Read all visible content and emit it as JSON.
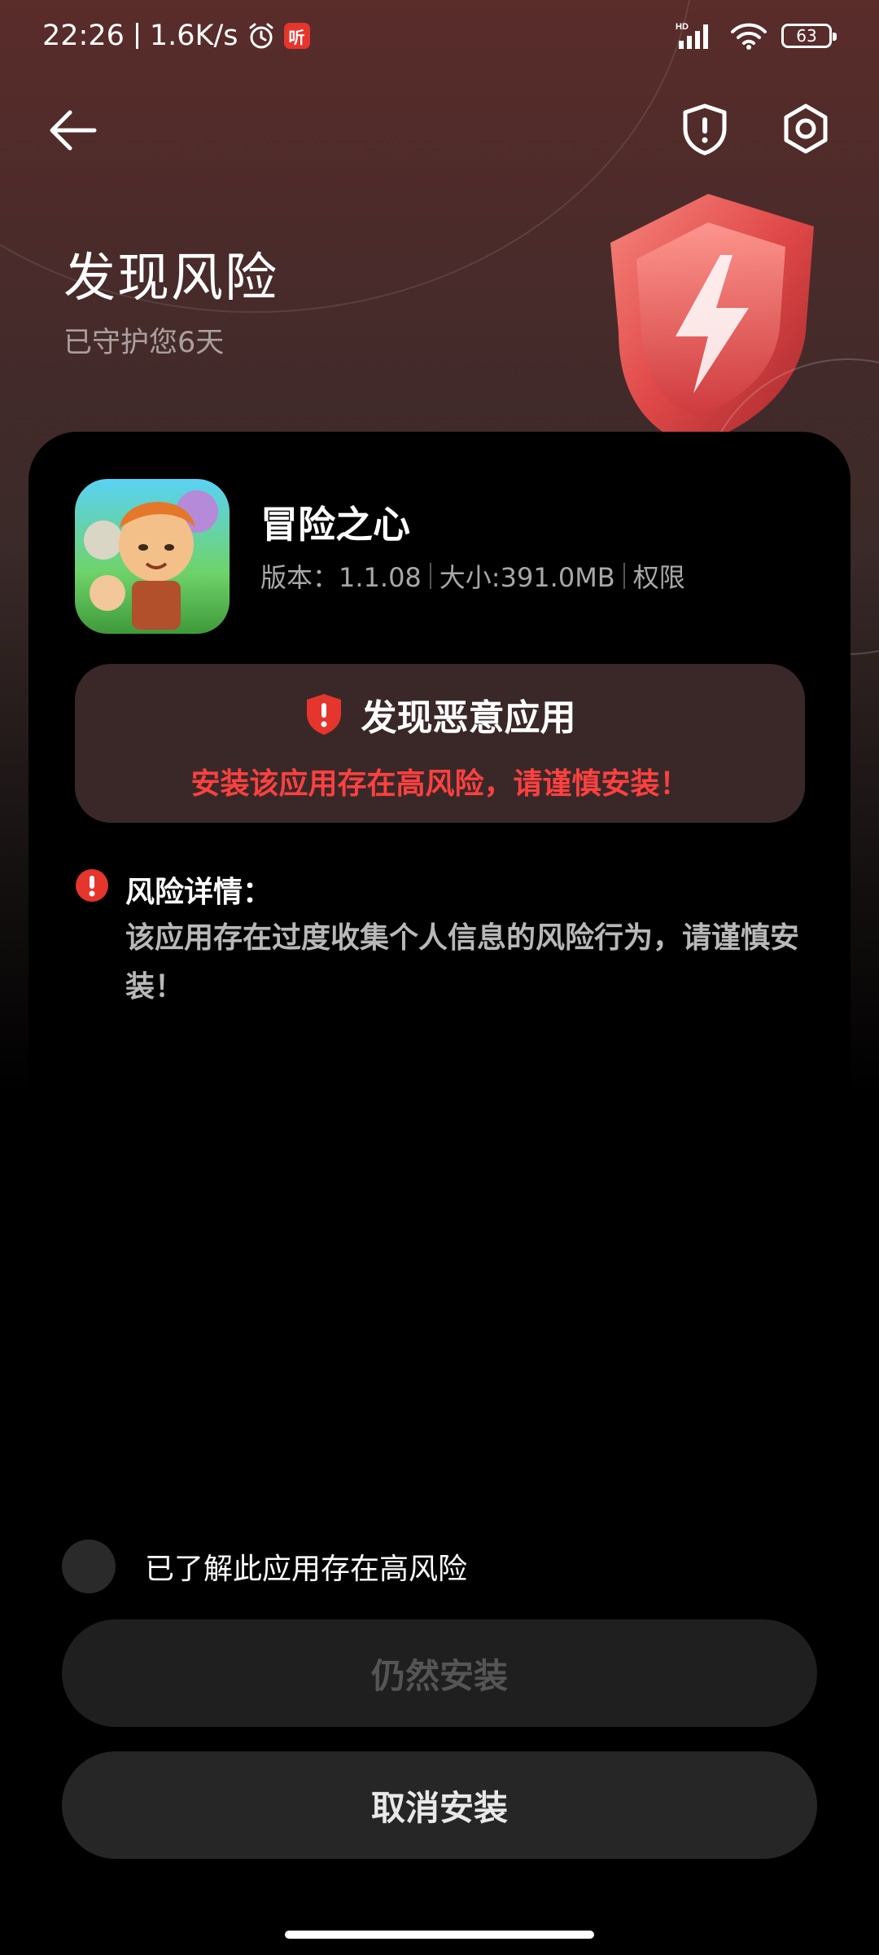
{
  "status_bar": {
    "time": "22:26",
    "network_speed": "1.6K/s",
    "ting_badge": "听",
    "network_type": "HD",
    "battery": "63"
  },
  "header": {
    "title": "发现风险",
    "subtitle": "已守护您6天"
  },
  "app": {
    "name": "冒险之心",
    "version": "版本：1.1.08",
    "size": "大小:391.0MB",
    "permissions_link": "权限"
  },
  "alert": {
    "title": "发现恶意应用",
    "message": "安装该应用存在高风险，请谨慎安装！"
  },
  "risk": {
    "title": "风险详情：",
    "description": "该应用存在过度收集个人信息的风险行为，请谨慎安装！"
  },
  "acknowledge": {
    "label": "已了解此应用存在高风险",
    "checked": false
  },
  "buttons": {
    "install_anyway": "仍然安装",
    "cancel_install": "取消安装"
  },
  "colors": {
    "accent_red": "#ff4040",
    "alert_bg": "#3a2828",
    "badge_red": "#e5352d"
  }
}
